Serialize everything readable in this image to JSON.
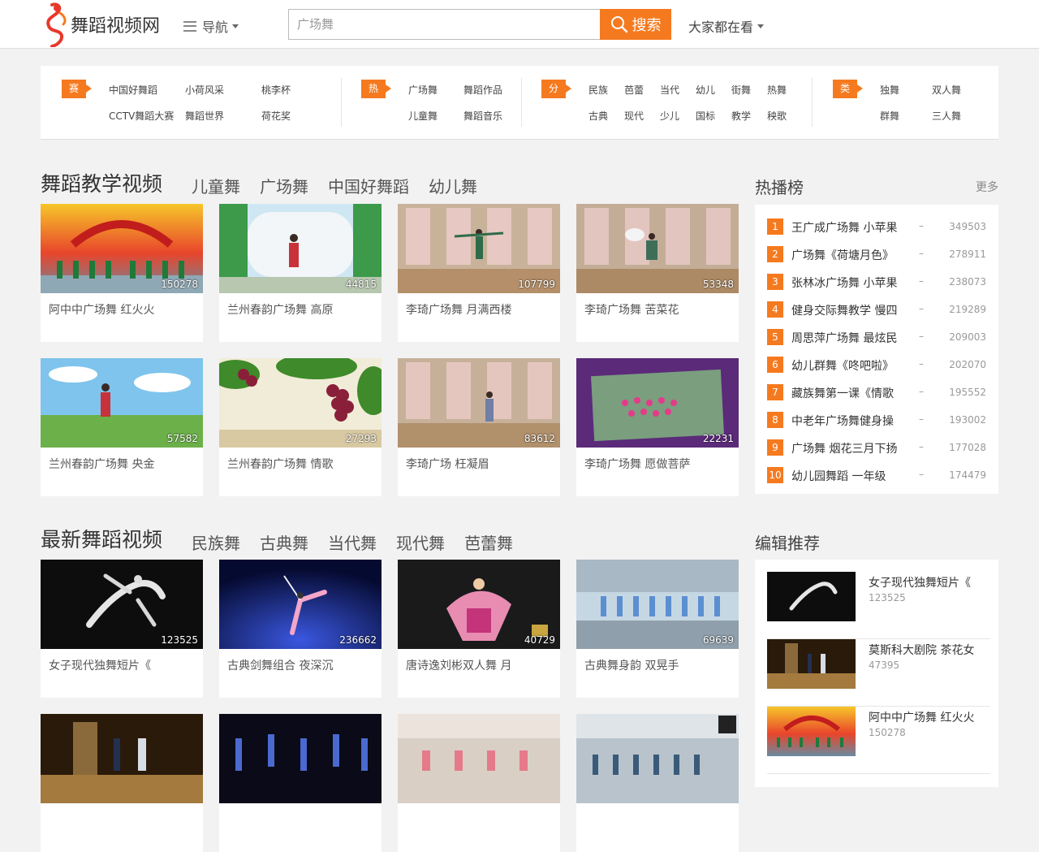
{
  "header": {
    "logo_text": "舞蹈视频网",
    "nav_label": "导航",
    "search_placeholder": "广场舞",
    "search_button": "搜索",
    "watching_label": "大家都在看"
  },
  "categories": {
    "event": {
      "tag": "赛事",
      "links": [
        "中国好舞蹈",
        "小荷风采",
        "桃李杯",
        "CCTV舞蹈大赛",
        "舞蹈世界",
        "荷花奖"
      ]
    },
    "hot": {
      "tag": "热门",
      "links": [
        "广场舞",
        "舞蹈作品",
        "儿童舞",
        "舞蹈音乐"
      ]
    },
    "classify": {
      "tag": "分类",
      "links": [
        "民族",
        "芭蕾",
        "当代",
        "幼儿",
        "街舞",
        "热舞",
        "古典",
        "现代",
        "少儿",
        "国标",
        "教学",
        "秧歌"
      ]
    },
    "type": {
      "tag": "类型",
      "links": [
        "独舞",
        "双人舞",
        "群舞",
        "三人舞"
      ]
    }
  },
  "teaching": {
    "title": "舞蹈教学视频",
    "tabs": [
      "儿童舞",
      "广场舞",
      "中国好舞蹈",
      "幼儿舞"
    ],
    "videos": [
      {
        "title": "阿中中广场舞 红火火",
        "count": "150278"
      },
      {
        "title": "兰州春韵广场舞 高原",
        "count": "44815"
      },
      {
        "title": "李琦广场舞 月满西楼",
        "count": "107799"
      },
      {
        "title": "李琦广场舞 苦菜花",
        "count": "53348"
      },
      {
        "title": "兰州春韵广场舞 央金",
        "count": "57582"
      },
      {
        "title": "兰州春韵广场舞 情歌",
        "count": "27293"
      },
      {
        "title": "李琦广场 枉凝眉",
        "count": "83612"
      },
      {
        "title": "李琦广场舞 愿做菩萨",
        "count": "22231"
      }
    ]
  },
  "latest": {
    "title": "最新舞蹈视频",
    "tabs": [
      "民族舞",
      "古典舞",
      "当代舞",
      "现代舞",
      "芭蕾舞"
    ],
    "videos": [
      {
        "title": "女子现代独舞短片《",
        "count": "123525"
      },
      {
        "title": "古典剑舞组合 夜深沉",
        "count": "236662"
      },
      {
        "title": "唐诗逸刘彬双人舞 月",
        "count": "40729"
      },
      {
        "title": "古典舞身韵 双晃手",
        "count": "69639"
      }
    ]
  },
  "ranking": {
    "title": "热播榜",
    "more": "更多",
    "items": [
      {
        "num": "1",
        "name": "王广成广场舞 小苹果",
        "dash": "–",
        "count": "349503"
      },
      {
        "num": "2",
        "name": "广场舞《荷塘月色》",
        "dash": "–",
        "count": "278911"
      },
      {
        "num": "3",
        "name": "张林冰广场舞 小苹果",
        "dash": "–",
        "count": "238073"
      },
      {
        "num": "4",
        "name": "健身交际舞教学 慢四",
        "dash": "–",
        "count": "219289"
      },
      {
        "num": "5",
        "name": "周思萍广场舞 最炫民",
        "dash": "–",
        "count": "209003"
      },
      {
        "num": "6",
        "name": "幼儿群舞《咚吧啦》",
        "dash": "–",
        "count": "202070"
      },
      {
        "num": "7",
        "name": "藏族舞第一课《情歌",
        "dash": "–",
        "count": "195552"
      },
      {
        "num": "8",
        "name": "中老年广场舞健身操",
        "dash": "–",
        "count": "193002"
      },
      {
        "num": "9",
        "name": "广场舞 烟花三月下扬",
        "dash": "–",
        "count": "177028"
      },
      {
        "num": "10",
        "name": "幼儿园舞蹈 一年级",
        "dash": "–",
        "count": "174479"
      }
    ]
  },
  "editor": {
    "title": "编辑推荐",
    "items": [
      {
        "title": "女子现代独舞短片《",
        "count": "123525"
      },
      {
        "title": "莫斯科大剧院 茶花女",
        "count": "47395"
      },
      {
        "title": "阿中中广场舞 红火火",
        "count": "150278"
      }
    ]
  },
  "colors": {
    "accent": "#f57a1f"
  }
}
